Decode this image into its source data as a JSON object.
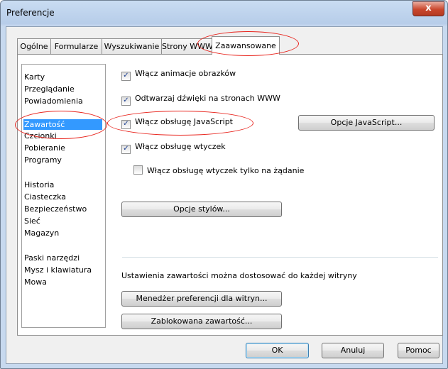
{
  "window": {
    "title": "Preferencje",
    "close_glyph": "x"
  },
  "tabs": [
    {
      "label": "Ogólne",
      "active": false
    },
    {
      "label": "Formularze",
      "active": false
    },
    {
      "label": "Wyszukiwanie",
      "active": false
    },
    {
      "label": "Strony WWW",
      "active": false
    },
    {
      "label": "Zaawansowane",
      "active": true
    }
  ],
  "sidebar": {
    "items": [
      "Karty",
      "Przeglądanie",
      "Powiadomienia",
      "Zawartość",
      "Czcionki",
      "Pobieranie",
      "Programy",
      "Historia",
      "Ciasteczka",
      "Bezpieczeństwo",
      "Sieć",
      "Magazyn",
      "Paski narzędzi",
      "Mysz i klawiatura",
      "Mowa"
    ],
    "selected": "Zawartość"
  },
  "options": {
    "animations": {
      "label": "Włącz animacje obrazków",
      "checked": true
    },
    "sounds": {
      "label": "Odtwarzaj dźwięki na stronach WWW",
      "checked": true
    },
    "javascript": {
      "label": "Włącz obsługę JavaScript",
      "checked": true
    },
    "plugins": {
      "label": "Włącz obsługę wtyczek",
      "checked": true
    },
    "plugins_on_demand": {
      "label": "Włącz obsługę wtyczek tylko na żądanie",
      "checked": false
    }
  },
  "buttons": {
    "js_options": "Opcje JavaScript...",
    "style_options": "Opcje stylów...",
    "site_prefs": "Menedżer preferencji dla witryn...",
    "blocked_content": "Zablokowana zawartość...",
    "ok": "OK",
    "cancel": "Anuluj",
    "help": "Pomoc"
  },
  "site_info_text": "Ustawienia zawartości można dostosować do każdej witryny",
  "check_glyph": "✓",
  "annotation_color": "#e8231c"
}
